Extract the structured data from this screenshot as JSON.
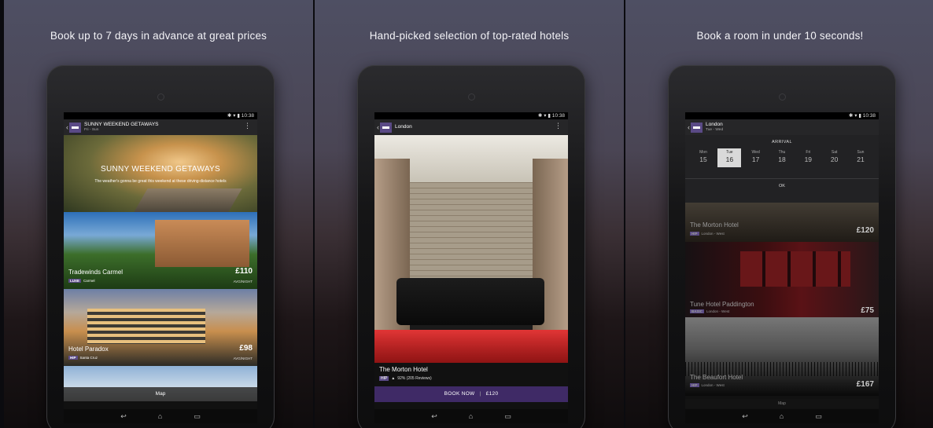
{
  "panels": [
    {
      "caption": "Book up to 7 days in advance at great prices",
      "status_time": "10:38",
      "appbar": {
        "title": "SUNNY WEEKEND GETAWAYS",
        "subtitle": "Fri - Sun"
      },
      "hero": {
        "title": "SUNNY WEEKEND GETAWAYS",
        "subtitle": "The weather's gonna be great this weekend at these driving-distance hotels"
      },
      "hotels": [
        {
          "name": "Tradewinds Carmel",
          "price": "£110",
          "price_note": "AVG/NIGHT",
          "category": "LUXE",
          "location": "Carmel"
        },
        {
          "name": "Hotel Paradox",
          "price": "£98",
          "price_note": "AVG/NIGHT",
          "category": "HIP",
          "location": "Santa Cruz"
        }
      ],
      "map_label": "Map"
    },
    {
      "caption": "Hand-picked selection of top-rated hotels",
      "status_time": "10:38",
      "appbar": {
        "title": "London"
      },
      "hotel": {
        "name": "The Morton Hotel",
        "category": "HIP",
        "rating": "92% (205 Reviews)"
      },
      "book": {
        "label": "BOOK NOW",
        "price": "£120"
      }
    },
    {
      "caption": "Book a room in under 10 seconds!",
      "status_time": "10:38",
      "appbar": {
        "title": "London",
        "subtitle": "Tue - Wed"
      },
      "calendar": {
        "title": "ARRIVAL",
        "days": [
          {
            "dow": "Mon",
            "date": "15"
          },
          {
            "dow": "Tue",
            "date": "16"
          },
          {
            "dow": "Wed",
            "date": "17"
          },
          {
            "dow": "Thu",
            "date": "18"
          },
          {
            "dow": "Fri",
            "date": "19"
          },
          {
            "dow": "Sat",
            "date": "20"
          },
          {
            "dow": "Sun",
            "date": "21"
          }
        ],
        "selected_index": 1,
        "ok_label": "OK"
      },
      "hotels": [
        {
          "name": "The Morton Hotel",
          "price": "£120",
          "category": "HIP",
          "location": "London - West"
        },
        {
          "name": "Tune Hotel Paddington",
          "price": "£75",
          "category": "BASIC",
          "location": "London - West"
        },
        {
          "name": "The Beaufort Hotel",
          "price": "£167",
          "category": "HIP",
          "location": "London - West"
        }
      ],
      "map_label": "Map"
    }
  ],
  "icons": {
    "back": "back-arrow-icon",
    "menu": "overflow-menu-icon",
    "home": "home-icon",
    "recents": "recents-icon"
  }
}
